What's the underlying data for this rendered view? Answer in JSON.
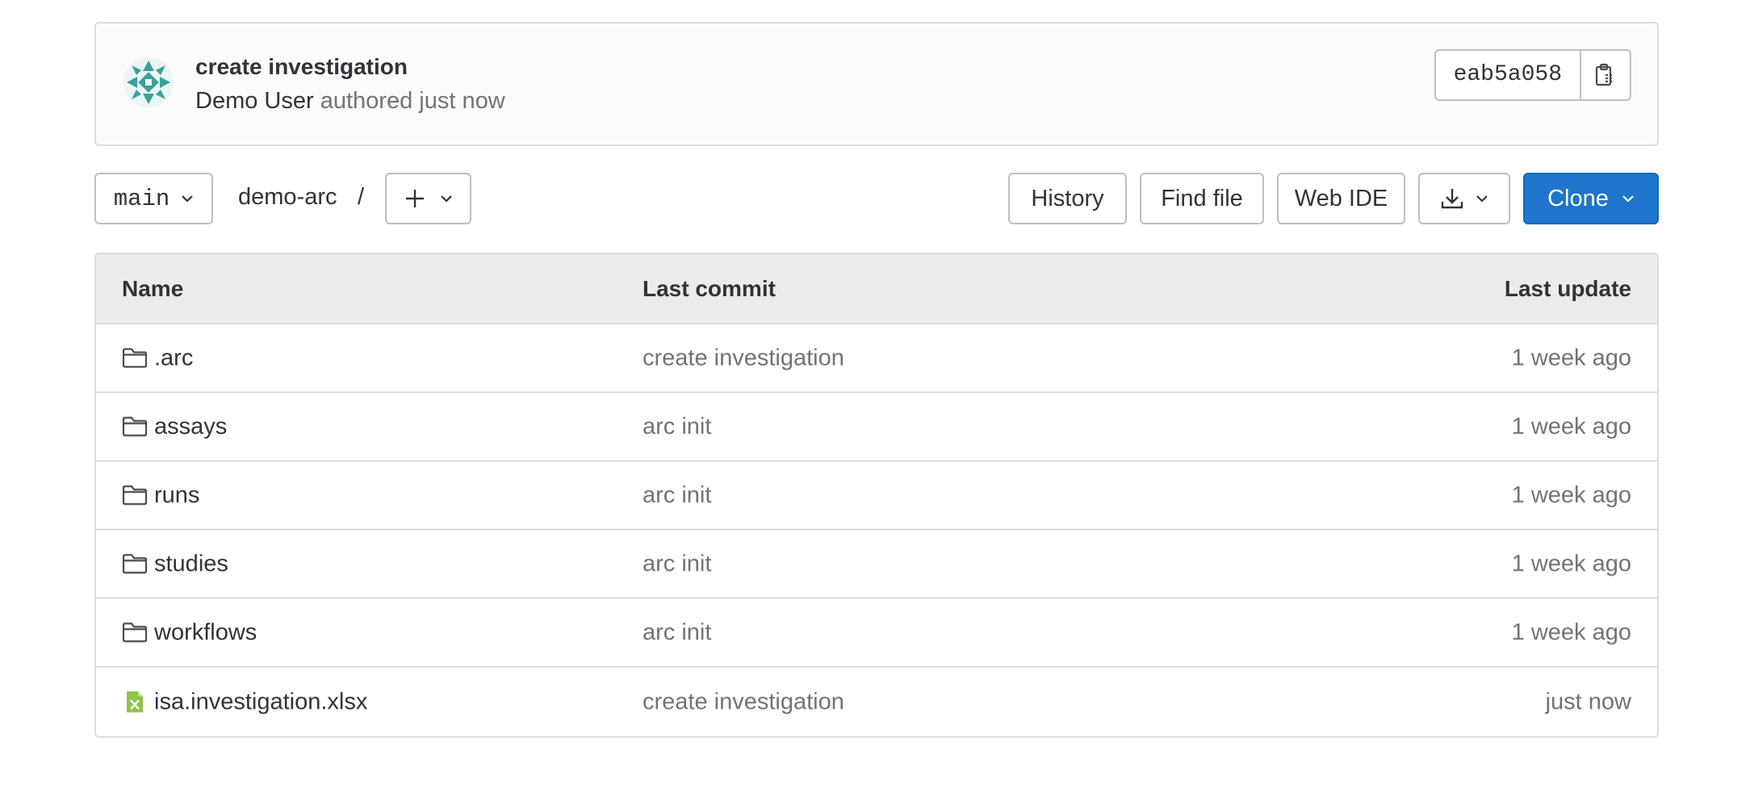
{
  "commit": {
    "title": "create investigation",
    "author": "Demo User",
    "authored_text": "authored just now",
    "sha": "eab5a058"
  },
  "toolbar": {
    "branch": "main",
    "repo": "demo-arc",
    "separator": "/",
    "history_label": "History",
    "find_file_label": "Find file",
    "web_ide_label": "Web IDE",
    "clone_label": "Clone"
  },
  "table": {
    "headers": {
      "name": "Name",
      "last_commit": "Last commit",
      "last_update": "Last update"
    },
    "rows": [
      {
        "name": ".arc",
        "type": "folder",
        "commit": "create investigation",
        "updated": "1 week ago"
      },
      {
        "name": "assays",
        "type": "folder",
        "commit": "arc init",
        "updated": "1 week ago"
      },
      {
        "name": "runs",
        "type": "folder",
        "commit": "arc init",
        "updated": "1 week ago"
      },
      {
        "name": "studies",
        "type": "folder",
        "commit": "arc init",
        "updated": "1 week ago"
      },
      {
        "name": "workflows",
        "type": "folder",
        "commit": "arc init",
        "updated": "1 week ago"
      },
      {
        "name": "isa.investigation.xlsx",
        "type": "spreadsheet",
        "commit": "create investigation",
        "updated": "just now"
      }
    ]
  },
  "colors": {
    "primary": "#1f75cb",
    "avatar": "#3aa19a",
    "spreadsheet_icon": "#8fc34a"
  }
}
